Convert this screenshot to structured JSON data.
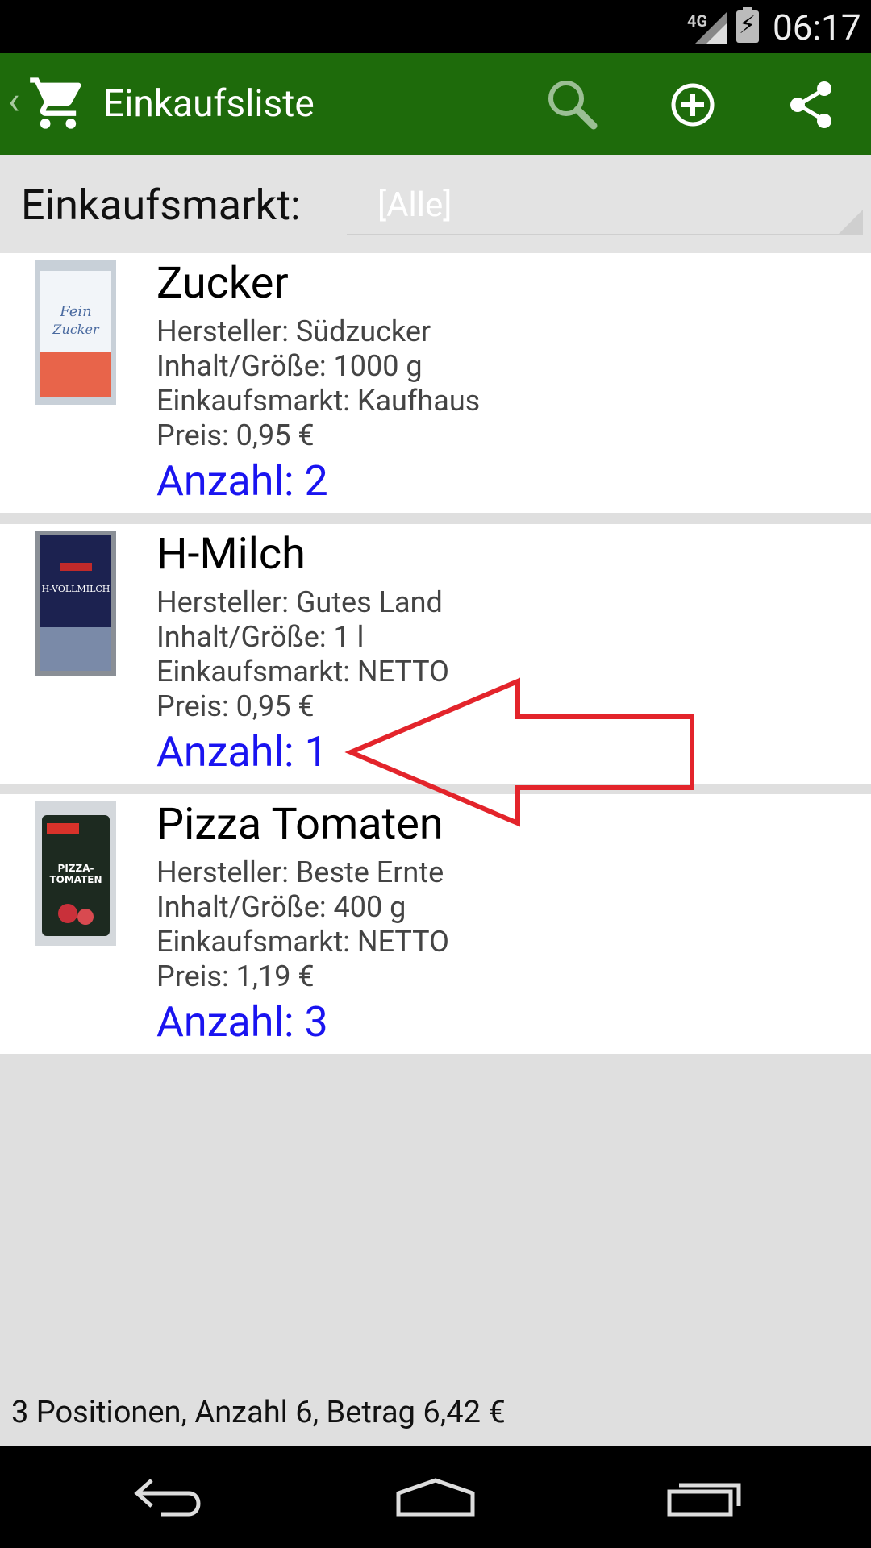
{
  "status_bar": {
    "network": "4G",
    "time": "06:17"
  },
  "action_bar": {
    "title": "Einkaufsliste",
    "icons": [
      "back-chevron-icon",
      "shopping-cart-icon",
      "search-icon",
      "add-circle-icon",
      "share-icon"
    ]
  },
  "filter": {
    "label": "Einkaufsmarkt:",
    "selected": "[Alle]"
  },
  "items": [
    {
      "name": "Zucker",
      "manufacturer": "Hersteller: Südzucker",
      "size": "Inhalt/Größe: 1000 g",
      "store": "Einkaufsmarkt: Kaufhaus",
      "price": "Preis: 0,95 €",
      "quantity": "Anzahl: 2"
    },
    {
      "name": "H-Milch",
      "manufacturer": "Hersteller: Gutes Land",
      "size": "Inhalt/Größe: 1 l",
      "store": "Einkaufsmarkt: NETTO",
      "price": "Preis: 0,95 €",
      "quantity": "Anzahl: 1"
    },
    {
      "name": "Pizza Tomaten",
      "manufacturer": "Hersteller: Beste Ernte",
      "size": "Inhalt/Größe: 400 g",
      "store": "Einkaufsmarkt: NETTO",
      "price": "Preis: 1,19 €",
      "quantity": "Anzahl: 3"
    }
  ],
  "footer": {
    "summary": "3 Positionen, Anzahl 6, Betrag 6,42 €"
  },
  "colors": {
    "action_bar": "#1e6b0b",
    "quantity": "#1a14f0",
    "annotation_arrow": "#e3242b"
  }
}
